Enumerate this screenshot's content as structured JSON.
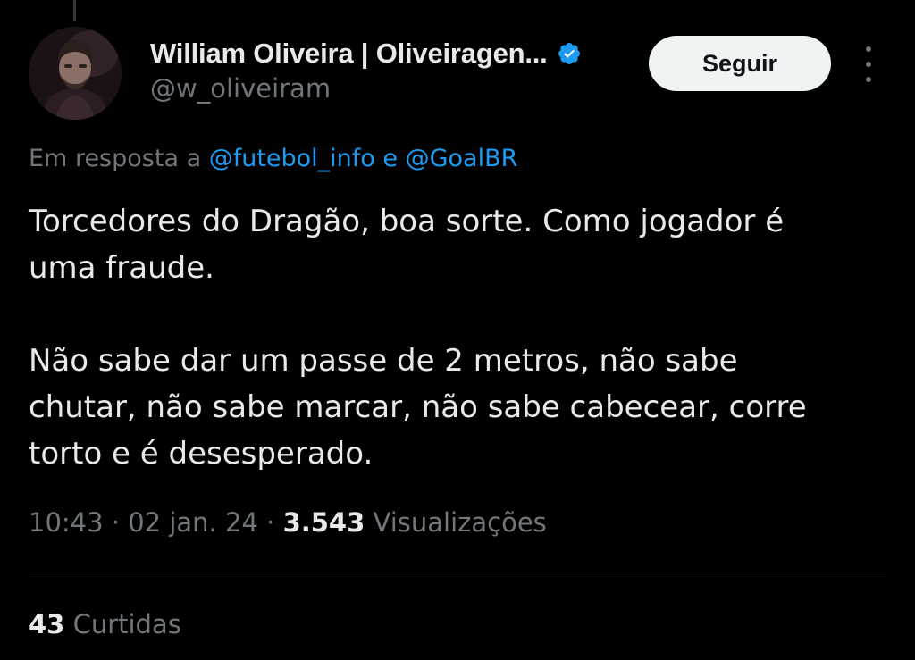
{
  "author": {
    "display_name": "William Oliveira | Oliveiragen...",
    "handle": "@w_oliveiram",
    "verified": true,
    "verified_color": "#1d9bf0"
  },
  "actions": {
    "follow_label": "Seguir"
  },
  "reply_context": {
    "prefix": "Em resposta a ",
    "mention_1": "@futebol_info",
    "conjunction": " e ",
    "mention_2": "@GoalBR"
  },
  "tweet": {
    "paragraph_1": "Torcedores do Dragão, boa sorte. Como jogador é\numa fraude.",
    "paragraph_2": "Não sabe dar um passe de 2 metros, não sabe\nchutar, não sabe marcar, não sabe cabecear, corre\ntorto e é desesperado."
  },
  "meta": {
    "time": "10:43",
    "separator": " · ",
    "date": "02 jan. 24",
    "separator_2": " · ",
    "views_count": "3.543",
    "views_label": " Visualizações"
  },
  "engagement": {
    "likes_count": "43",
    "likes_label": " Curtidas"
  },
  "colors": {
    "background": "#000000",
    "text_primary": "#e7e9ea",
    "text_secondary": "#71767b",
    "accent": "#1d9bf0",
    "button_bg": "#eff3f4"
  }
}
